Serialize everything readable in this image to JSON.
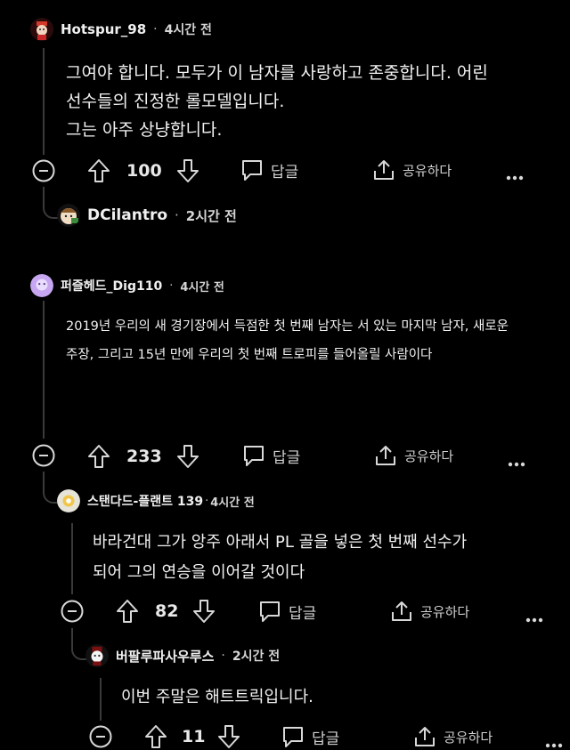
{
  "comments": [
    {
      "username": "Hotspur_98",
      "time": "4시간 전",
      "lines": [
        "그여야 합니다. 모두가 이 남자를 사랑하고 존중합니다. 어린",
        "선수들의 진정한 롤모델입니다.",
        "그는 아주 상냥합니다."
      ],
      "votes": "100",
      "reply_label": "답글",
      "share_label": "공유하다"
    },
    {
      "username": "DCilantro",
      "time": "2시간 전"
    },
    {
      "username": "퍼즐헤드_Dig110",
      "time": "4시간 전",
      "lines": [
        "2019년 우리의 새 경기장에서 득점한 첫 번째 남자는 서 있는 마지막 남자, 새로운",
        "주장, 그리고 15년 만에 우리의 첫 번째 트로피를 들어올릴 사람이다"
      ],
      "votes": "233",
      "reply_label": "답글",
      "share_label": "공유하다"
    },
    {
      "username": "스탠다드-플랜트 139",
      "time": "4시간 전",
      "lines": [
        "바라건대 그가 앙주 아래서 PL 골을 넣은 첫 번째 선수가",
        "되어 그의 연승을 이어갈 것이다"
      ],
      "votes": "82",
      "reply_label": "답글",
      "share_label": "공유하다"
    },
    {
      "username": "버팔루파사우루스",
      "time": "2시간 전",
      "lines": [
        "이번 주말은 해트트릭입니다."
      ],
      "votes": "11",
      "reply_label": "답글",
      "share_label": "공유하다"
    }
  ],
  "separator": "·",
  "colors": {
    "background": "#000000",
    "thread_line": "#3a3a3a",
    "text": "#f2f2f2",
    "muted": "#cfcfcf"
  },
  "icons": [
    "collapse-icon",
    "upvote-icon",
    "downvote-icon",
    "reply-icon",
    "share-icon",
    "more-icon"
  ]
}
